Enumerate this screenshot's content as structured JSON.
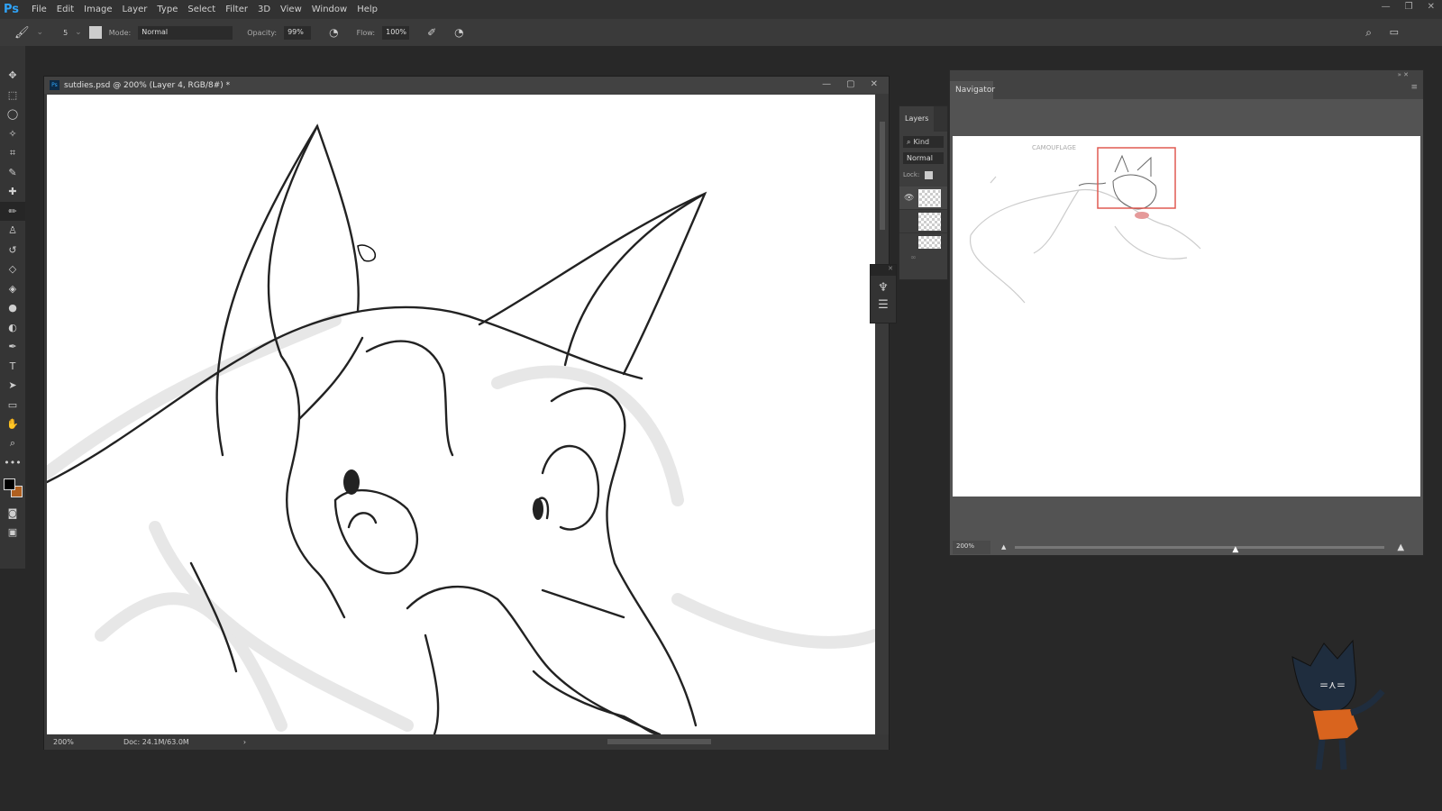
{
  "app": {
    "logo": "Ps"
  },
  "menu": [
    "File",
    "Edit",
    "Image",
    "Layer",
    "Type",
    "Select",
    "Filter",
    "3D",
    "View",
    "Window",
    "Help"
  ],
  "options": {
    "brush_size": "5",
    "mode_label": "Mode:",
    "mode_value": "Normal",
    "opacity_label": "Opacity:",
    "opacity_value": "99%",
    "flow_label": "Flow:",
    "flow_value": "100%"
  },
  "document": {
    "title": "sutdies.psd @ 200% (Layer 4, RGB/8#) *",
    "zoom": "200%",
    "doc_size": "Doc: 24.1M/63.0M"
  },
  "layers": {
    "tab": "Layers",
    "filter": "Kind",
    "blend": "Normal",
    "lock_label": "Lock:"
  },
  "navigator": {
    "tab": "Navigator",
    "zoom": "200%",
    "slider_fraction": 0.6,
    "view_box_color": "#e05a52",
    "sketch_note": "CAMOUFLAGE"
  },
  "colors": {
    "accent": "#31a8ff",
    "foreground": "#000000",
    "background": "#b06020"
  }
}
